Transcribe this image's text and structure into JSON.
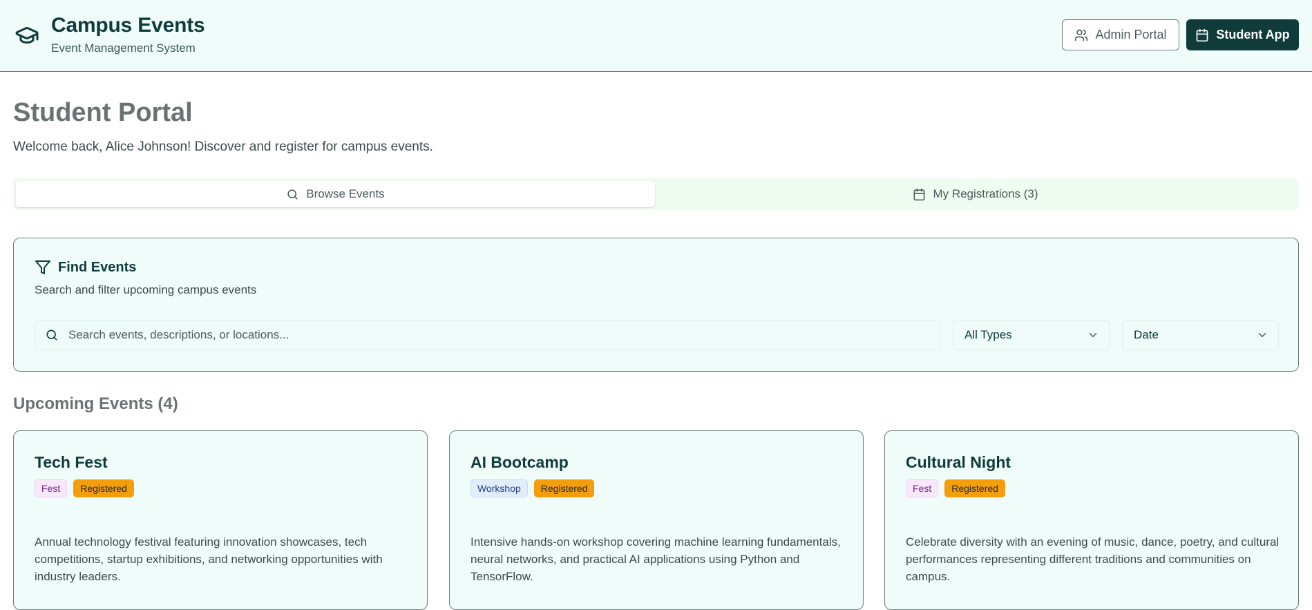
{
  "header": {
    "brand_title": "Campus Events",
    "brand_subtitle": "Event Management System",
    "brand_icon": "graduation-cap-icon",
    "admin_button": "Admin Portal",
    "student_button": "Student App"
  },
  "page": {
    "title": "Student Portal",
    "welcome": "Welcome back, Alice Johnson! Discover and register for campus events."
  },
  "tabs": [
    {
      "label": "Browse Events",
      "icon": "search-icon",
      "active": true
    },
    {
      "label": "My Registrations (3)",
      "icon": "calendar-icon",
      "active": false
    }
  ],
  "filters": {
    "title": "Find Events",
    "subtitle": "Search and filter upcoming campus events",
    "search_placeholder": "Search events, descriptions, or locations...",
    "type_selected": "All Types",
    "sort_selected": "Date"
  },
  "events_section": {
    "title": "Upcoming Events (4)"
  },
  "events": [
    {
      "title": "Tech Fest",
      "type": "Fest",
      "status": "Registered",
      "description": "Annual technology festival featuring innovation showcases, tech competitions, startup exhibitions, and networking opportunities with industry leaders."
    },
    {
      "title": "AI Bootcamp",
      "type": "Workshop",
      "status": "Registered",
      "description": "Intensive hands-on workshop covering machine learning fundamentals, neural networks, and practical AI applications using Python and TensorFlow."
    },
    {
      "title": "Cultural Night",
      "type": "Fest",
      "status": "Registered",
      "description": "Celebrate diversity with an evening of music, dance, poetry, and cultural performances representing different traditions and communities on campus."
    }
  ],
  "colors": {
    "primary": "#0f3b3a",
    "header_bg": "#effcf9",
    "registered": "#f59e0b"
  }
}
